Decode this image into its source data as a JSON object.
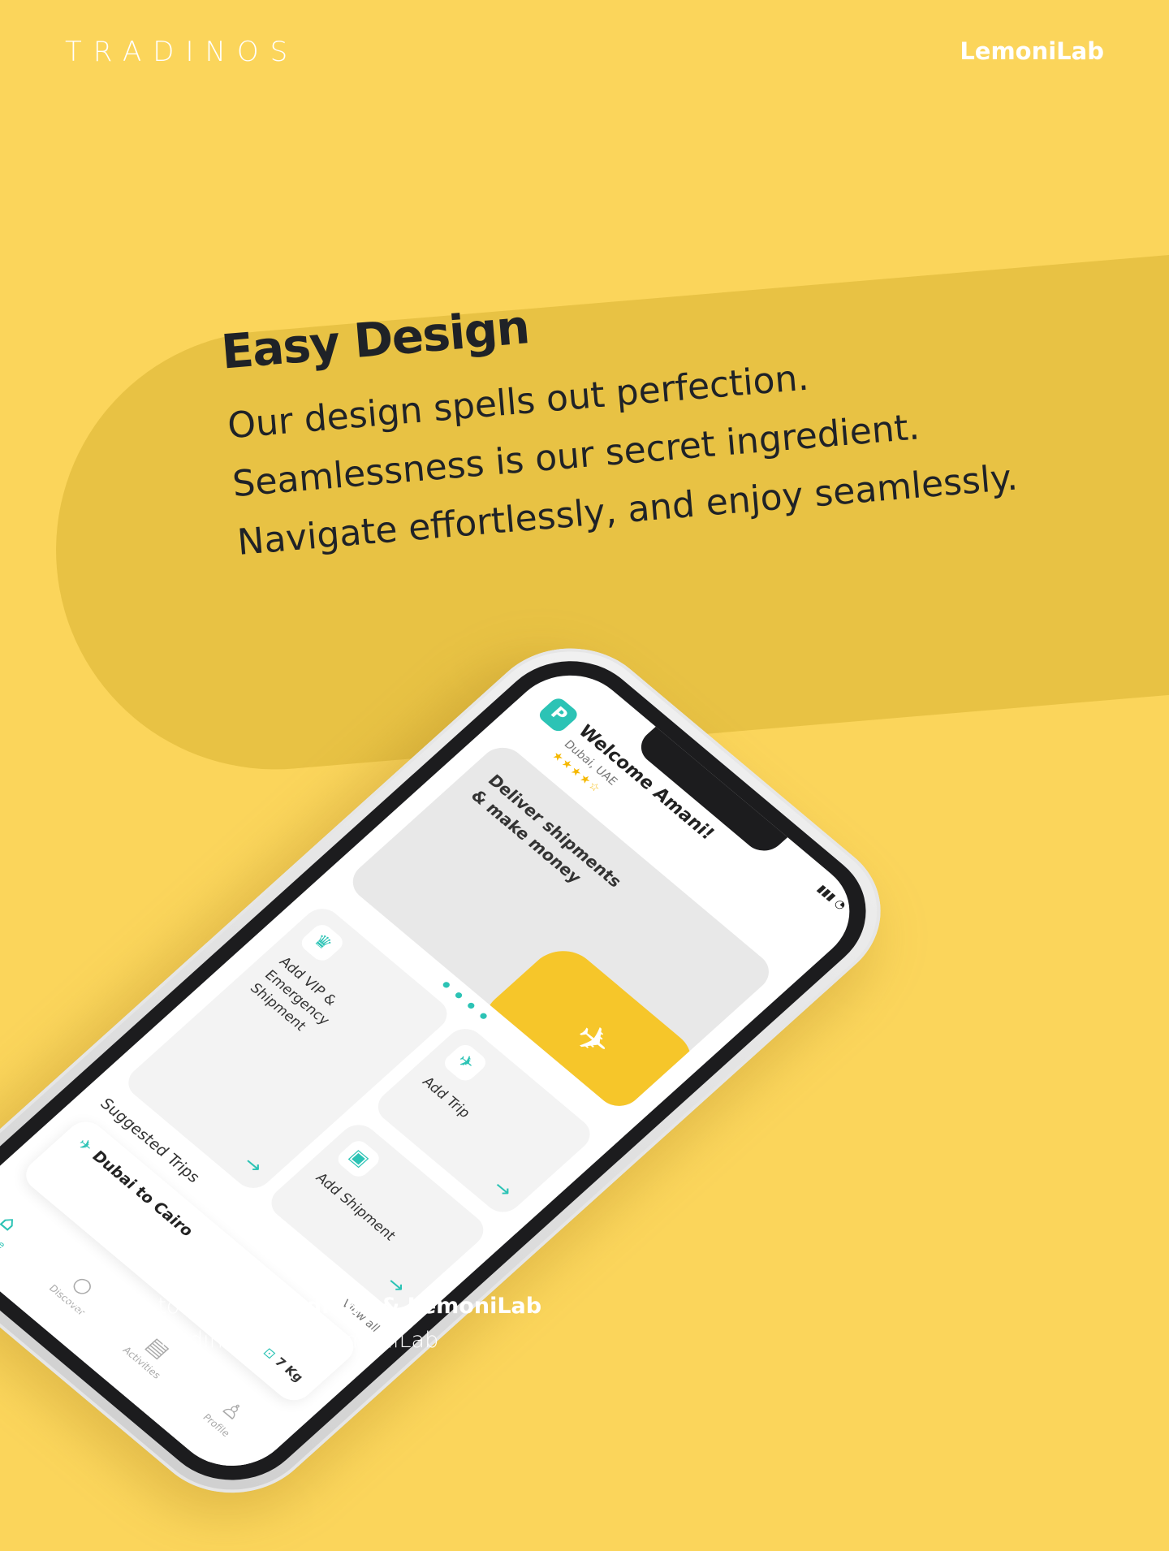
{
  "brand": {
    "left": "TRADINOS",
    "right": "LemoniLab"
  },
  "hero": {
    "title": "Easy Design",
    "lines": [
      "Our design spells out perfection.",
      "Seamlessness is our secret ingredient.",
      "Navigate effortlessly, and enjoy seamlessly."
    ]
  },
  "footer": {
    "brought_prefix": "Brought to you by ",
    "brought_bold": "Tradinos & LemoniLab",
    "copyright": "© 2023 Tradinos UG & LemoniLab"
  },
  "phone": {
    "logo_icon": "app-logo-icon",
    "welcome": "Welcome Amani!",
    "location": "Dubai, UAE",
    "rating": 4,
    "banner_text": "Deliver shipments & make money",
    "tiles": {
      "vip": {
        "label": "Add VIP & Emergency Shipment",
        "icon": "crown-icon"
      },
      "trip": {
        "label": "Add Trip",
        "icon": "plane-icon"
      },
      "shipment": {
        "label": "Add Shipment",
        "icon": "wallet-icon"
      }
    },
    "suggested_title": "Suggested Trips",
    "view_all": "View all",
    "trip": {
      "route": "Dubai to Cairo",
      "weight": "7 Kg"
    },
    "tabs": [
      "Home",
      "Discover",
      "Activities",
      "Profile"
    ],
    "accent_color": "#2CC3B5"
  },
  "colors": {
    "background": "#FBD55B",
    "pill": "#E8C244",
    "text_dark": "#1f2227"
  }
}
